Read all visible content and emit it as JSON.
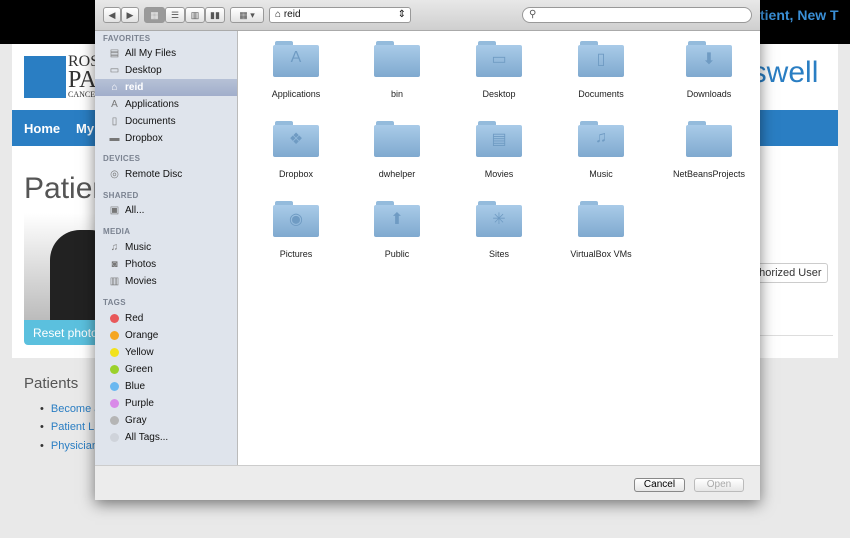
{
  "background_page": {
    "top_user": "tient, New T",
    "brand_partial": "oswell",
    "logo_text": [
      "ROS",
      "PA",
      "CANCE"
    ],
    "nav": [
      "Home",
      "My"
    ],
    "page_title_partial": "Patien",
    "reset_photo": "Reset photo",
    "authorized_user_partial": "uthorized User",
    "patients_heading": "Patients",
    "patient_links": [
      "Become a",
      "Patient Lif",
      "Physician"
    ]
  },
  "dialog": {
    "toolbar": {
      "back": "◀",
      "forward": "▶",
      "views": [
        "icon-view",
        "list-view",
        "column-view",
        "coverflow-view"
      ],
      "arrange": "▦ ▾",
      "location": "reid",
      "search_placeholder": ""
    },
    "sidebar": {
      "sections": [
        {
          "heading": "FAVORITES",
          "items": [
            {
              "label": "All My Files",
              "icon": "all-files-icon"
            },
            {
              "label": "Desktop",
              "icon": "desktop-icon"
            },
            {
              "label": "reid",
              "icon": "home-icon",
              "selected": true
            },
            {
              "label": "Applications",
              "icon": "applications-icon"
            },
            {
              "label": "Documents",
              "icon": "documents-icon"
            },
            {
              "label": "Dropbox",
              "icon": "folder-icon"
            }
          ]
        },
        {
          "heading": "DEVICES",
          "items": [
            {
              "label": "Remote Disc",
              "icon": "disc-icon"
            }
          ]
        },
        {
          "heading": "SHARED",
          "items": [
            {
              "label": "All...",
              "icon": "network-icon"
            }
          ]
        },
        {
          "heading": "MEDIA",
          "items": [
            {
              "label": "Music",
              "icon": "music-icon"
            },
            {
              "label": "Photos",
              "icon": "camera-icon"
            },
            {
              "label": "Movies",
              "icon": "film-icon"
            }
          ]
        }
      ],
      "tags_heading": "TAGS",
      "tags": [
        {
          "label": "Red",
          "color": "#e8585a"
        },
        {
          "label": "Orange",
          "color": "#f5a623"
        },
        {
          "label": "Yellow",
          "color": "#f2e21c"
        },
        {
          "label": "Green",
          "color": "#9bd12a"
        },
        {
          "label": "Blue",
          "color": "#6ab8f0"
        },
        {
          "label": "Purple",
          "color": "#d98ae8"
        },
        {
          "label": "Gray",
          "color": "#b5b5b5"
        },
        {
          "label": "All Tags...",
          "color": "#cfd3da"
        }
      ]
    },
    "files": [
      {
        "name": "Applications",
        "glyph": "A"
      },
      {
        "name": "bin",
        "glyph": ""
      },
      {
        "name": "Desktop",
        "glyph": "▭"
      },
      {
        "name": "Documents",
        "glyph": "▯"
      },
      {
        "name": "Downloads",
        "glyph": "⬇"
      },
      {
        "name": "Dropbox",
        "glyph": "❖"
      },
      {
        "name": "dwhelper",
        "glyph": ""
      },
      {
        "name": "Movies",
        "glyph": "▤"
      },
      {
        "name": "Music",
        "glyph": "♫"
      },
      {
        "name": "NetBeansProjects",
        "glyph": ""
      },
      {
        "name": "Pictures",
        "glyph": "◉"
      },
      {
        "name": "Public",
        "glyph": "⬆"
      },
      {
        "name": "Sites",
        "glyph": "✳"
      },
      {
        "name": "VirtualBox VMs",
        "glyph": ""
      }
    ],
    "buttons": {
      "cancel": "Cancel",
      "open": "Open"
    }
  }
}
